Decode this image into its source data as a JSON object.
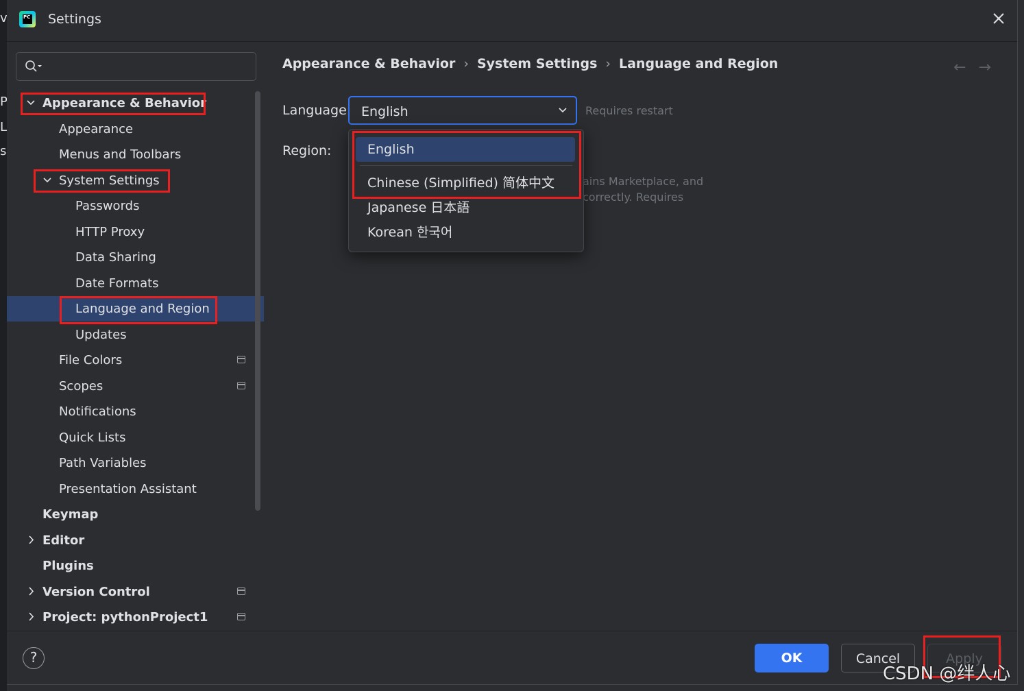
{
  "window": {
    "title": "Settings",
    "app_icon_label": "PC"
  },
  "edge_fragments": [
    "v",
    "Pr",
    "L",
    "s"
  ],
  "search": {
    "value": "",
    "placeholder": ""
  },
  "sidebar": {
    "items": [
      {
        "label": "Appearance & Behavior",
        "level": 0,
        "bold": true,
        "expanded": true
      },
      {
        "label": "Appearance",
        "level": 1
      },
      {
        "label": "Menus and Toolbars",
        "level": 1
      },
      {
        "label": "System Settings",
        "level": 1,
        "expanded": true
      },
      {
        "label": "Passwords",
        "level": 2
      },
      {
        "label": "HTTP Proxy",
        "level": 2
      },
      {
        "label": "Data Sharing",
        "level": 2
      },
      {
        "label": "Date Formats",
        "level": 2
      },
      {
        "label": "Language and Region",
        "level": 2,
        "selected": true
      },
      {
        "label": "Updates",
        "level": 2
      },
      {
        "label": "File Colors",
        "level": 1,
        "project_icon": true
      },
      {
        "label": "Scopes",
        "level": 1,
        "project_icon": true
      },
      {
        "label": "Notifications",
        "level": 1
      },
      {
        "label": "Quick Lists",
        "level": 1
      },
      {
        "label": "Path Variables",
        "level": 1
      },
      {
        "label": "Presentation Assistant",
        "level": 1
      },
      {
        "label": "Keymap",
        "level": 0,
        "bold": true
      },
      {
        "label": "Editor",
        "level": 0,
        "bold": true,
        "collapsed": true
      },
      {
        "label": "Plugins",
        "level": 0,
        "bold": true
      },
      {
        "label": "Version Control",
        "level": 0,
        "bold": true,
        "collapsed": true,
        "project_icon": true
      },
      {
        "label": "Project: pythonProject1",
        "level": 0,
        "bold": true,
        "collapsed": true,
        "project_icon": true
      }
    ]
  },
  "breadcrumb": {
    "items": [
      "Appearance & Behavior",
      "System Settings",
      "Language and Region"
    ],
    "separator": "›"
  },
  "nav": {
    "back": "←",
    "forward": "→"
  },
  "form": {
    "language_label": "Language:",
    "language_value": "English",
    "requires_restart": "Requires restart",
    "region_label": "Region:",
    "description_line1": "ains Marketplace, and",
    "description_line2": "correctly. Requires"
  },
  "language_options": [
    {
      "label": "English",
      "selected": true
    },
    {
      "label": "Chinese (Simplified) 简体中文"
    },
    {
      "label": "Japanese 日本語"
    },
    {
      "label": "Korean 한국어"
    }
  ],
  "footer": {
    "help": "?",
    "ok": "OK",
    "cancel": "Cancel",
    "apply": "Apply"
  },
  "watermark": "CSDN @绊人心",
  "colors": {
    "accent": "#3574f0",
    "selection": "#2e436e",
    "annotation_red": "#e8201f",
    "background": "#2b2d30"
  }
}
